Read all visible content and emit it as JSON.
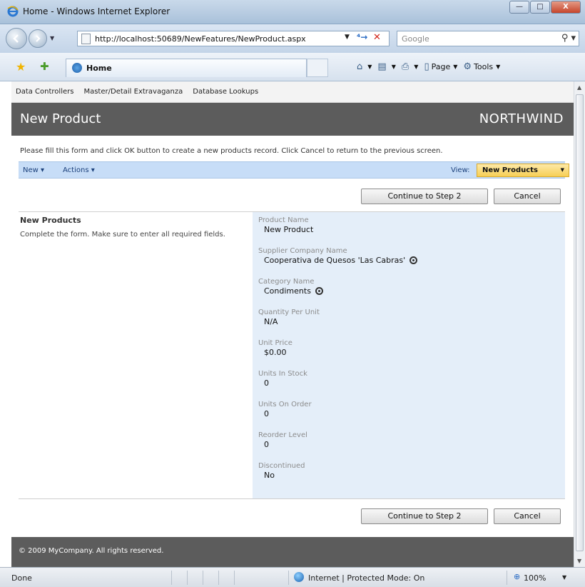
{
  "window": {
    "title": "Home - Windows Internet Explorer",
    "buttons": {
      "minimize": "—",
      "maximize": "□",
      "close": "X"
    }
  },
  "address_bar": {
    "url": "http://localhost:50689/NewFeatures/NewProduct.aspx",
    "search_placeholder": "Google"
  },
  "command_bar": {
    "tab_label": "Home",
    "tools": [
      {
        "name": "home-icon",
        "label": ""
      },
      {
        "name": "feeds-icon",
        "label": ""
      },
      {
        "name": "print-icon",
        "label": ""
      },
      {
        "name": "page-menu",
        "label": "Page"
      },
      {
        "name": "tools-menu",
        "label": "Tools"
      }
    ]
  },
  "app": {
    "menu": [
      "Data Controllers",
      "Master/Detail Extravaganza",
      "Database Lookups"
    ],
    "page_title": "New Product",
    "brand": "NORTHWIND",
    "instructions": "Please fill this form and click OK button to create a new products record. Click Cancel to return to the previous screen.",
    "actionbar": {
      "new_label": "New",
      "actions_label": "Actions",
      "view_label": "View:",
      "view_value": "New Products"
    },
    "buttons": {
      "continue": "Continue to Step 2",
      "cancel": "Cancel"
    },
    "left_panel": {
      "title": "New Products",
      "description": "Complete the form. Make sure to enter all required fields."
    },
    "fields": [
      {
        "label": "Product Name",
        "value": "New Product",
        "lookup": false
      },
      {
        "label": "Supplier Company Name",
        "value": "Cooperativa de Quesos 'Las Cabras'",
        "lookup": true
      },
      {
        "label": "Category Name",
        "value": "Condiments",
        "lookup": true
      },
      {
        "label": "Quantity Per Unit",
        "value": "N/A",
        "lookup": false
      },
      {
        "label": "Unit Price",
        "value": "$0.00",
        "lookup": false
      },
      {
        "label": "Units In Stock",
        "value": "0",
        "lookup": false
      },
      {
        "label": "Units On Order",
        "value": "0",
        "lookup": false
      },
      {
        "label": "Reorder Level",
        "value": "0",
        "lookup": false
      },
      {
        "label": "Discontinued",
        "value": "No",
        "lookup": false
      }
    ],
    "footer": "© 2009 MyCompany. All rights reserved."
  },
  "status_bar": {
    "status": "Done",
    "zone": "Internet | Protected Mode: On",
    "zoom": "100%"
  },
  "colors": {
    "header_band": "#5c5c5c",
    "actionbar": "#c7ddf7",
    "view_select": "#f7cf55",
    "form_panel": "#e4eef9"
  }
}
